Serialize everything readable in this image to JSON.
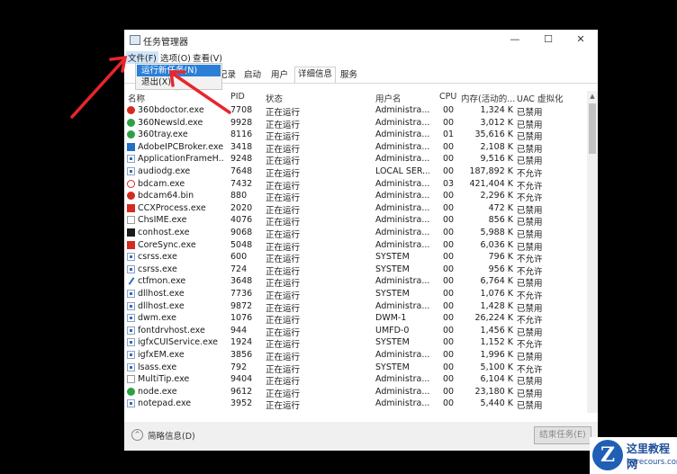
{
  "window": {
    "title": "任务管理器",
    "minimize": "—",
    "maximize": "☐",
    "close": "✕"
  },
  "menu": [
    "文件(F)",
    "选项(O)",
    "查看(V)"
  ],
  "dropdown": [
    "运行新任务(N)",
    "退出(X)"
  ],
  "tabs": [
    "记录",
    "启动",
    "用户",
    "详细信息",
    "服务"
  ],
  "columns": {
    "name": "名称",
    "pid": "PID",
    "status": "状态",
    "user": "用户名",
    "cpu": "CPU",
    "mem": "内存(活动的...",
    "uac": "UAC 虚拟化"
  },
  "processes": [
    {
      "name": "360bdoctor.exe",
      "pid": "7708",
      "status": "正在运行",
      "user": "Administra...",
      "cpu": "00",
      "mem": "1,324 K",
      "uac": "已禁用",
      "icon": "red"
    },
    {
      "name": "360Newsld.exe",
      "pid": "9928",
      "status": "正在运行",
      "user": "Administra...",
      "cpu": "00",
      "mem": "3,012 K",
      "uac": "已禁用",
      "icon": "green"
    },
    {
      "name": "360tray.exe",
      "pid": "8116",
      "status": "正在运行",
      "user": "Administra...",
      "cpu": "01",
      "mem": "35,616 K",
      "uac": "已禁用",
      "icon": "green"
    },
    {
      "name": "AdobeIPCBroker.exe",
      "pid": "3418",
      "status": "正在运行",
      "user": "Administra...",
      "cpu": "00",
      "mem": "2,108 K",
      "uac": "已禁用",
      "icon": "blue"
    },
    {
      "name": "ApplicationFrameH...",
      "pid": "9248",
      "status": "正在运行",
      "user": "Administra...",
      "cpu": "00",
      "mem": "9,516 K",
      "uac": "已禁用",
      "icon": "win"
    },
    {
      "name": "audiodg.exe",
      "pid": "7648",
      "status": "正在运行",
      "user": "LOCAL SER...",
      "cpu": "00",
      "mem": "187,892 K",
      "uac": "不允许",
      "icon": "win"
    },
    {
      "name": "bdcam.exe",
      "pid": "7432",
      "status": "正在运行",
      "user": "Administra...",
      "cpu": "03",
      "mem": "421,404 K",
      "uac": "不允许",
      "icon": "bd"
    },
    {
      "name": "bdcam64.bin",
      "pid": "880",
      "status": "正在运行",
      "user": "Administra...",
      "cpu": "00",
      "mem": "2,296 K",
      "uac": "不允许",
      "icon": "red"
    },
    {
      "name": "CCXProcess.exe",
      "pid": "2020",
      "status": "正在运行",
      "user": "Administra...",
      "cpu": "00",
      "mem": "472 K",
      "uac": "已禁用",
      "icon": "redsq"
    },
    {
      "name": "ChsIME.exe",
      "pid": "4076",
      "status": "正在运行",
      "user": "Administra...",
      "cpu": "00",
      "mem": "856 K",
      "uac": "已禁用",
      "icon": "plain"
    },
    {
      "name": "conhost.exe",
      "pid": "9068",
      "status": "正在运行",
      "user": "Administra...",
      "cpu": "00",
      "mem": "5,988 K",
      "uac": "已禁用",
      "icon": "dark"
    },
    {
      "name": "CoreSync.exe",
      "pid": "5048",
      "status": "正在运行",
      "user": "Administra...",
      "cpu": "00",
      "mem": "6,036 K",
      "uac": "已禁用",
      "icon": "redsq"
    },
    {
      "name": "csrss.exe",
      "pid": "600",
      "status": "正在运行",
      "user": "SYSTEM",
      "cpu": "00",
      "mem": "796 K",
      "uac": "不允许",
      "icon": "win"
    },
    {
      "name": "csrss.exe",
      "pid": "724",
      "status": "正在运行",
      "user": "SYSTEM",
      "cpu": "00",
      "mem": "956 K",
      "uac": "不允许",
      "icon": "win"
    },
    {
      "name": "ctfmon.exe",
      "pid": "3648",
      "status": "正在运行",
      "user": "Administra...",
      "cpu": "00",
      "mem": "6,764 K",
      "uac": "已禁用",
      "icon": "pen"
    },
    {
      "name": "dllhost.exe",
      "pid": "7736",
      "status": "正在运行",
      "user": "SYSTEM",
      "cpu": "00",
      "mem": "1,076 K",
      "uac": "不允许",
      "icon": "win"
    },
    {
      "name": "dllhost.exe",
      "pid": "9872",
      "status": "正在运行",
      "user": "Administra...",
      "cpu": "00",
      "mem": "1,428 K",
      "uac": "已禁用",
      "icon": "win"
    },
    {
      "name": "dwm.exe",
      "pid": "1076",
      "status": "正在运行",
      "user": "DWM-1",
      "cpu": "00",
      "mem": "26,224 K",
      "uac": "不允许",
      "icon": "win"
    },
    {
      "name": "fontdrvhost.exe",
      "pid": "944",
      "status": "正在运行",
      "user": "UMFD-0",
      "cpu": "00",
      "mem": "1,456 K",
      "uac": "已禁用",
      "icon": "win"
    },
    {
      "name": "igfxCUIService.exe",
      "pid": "1924",
      "status": "正在运行",
      "user": "SYSTEM",
      "cpu": "00",
      "mem": "1,152 K",
      "uac": "不允许",
      "icon": "win"
    },
    {
      "name": "igfxEM.exe",
      "pid": "3856",
      "status": "正在运行",
      "user": "Administra...",
      "cpu": "00",
      "mem": "1,996 K",
      "uac": "已禁用",
      "icon": "win"
    },
    {
      "name": "lsass.exe",
      "pid": "792",
      "status": "正在运行",
      "user": "SYSTEM",
      "cpu": "00",
      "mem": "5,100 K",
      "uac": "不允许",
      "icon": "win"
    },
    {
      "name": "MultiTip.exe",
      "pid": "9404",
      "status": "正在运行",
      "user": "Administra...",
      "cpu": "00",
      "mem": "6,104 K",
      "uac": "已禁用",
      "icon": "plain"
    },
    {
      "name": "node.exe",
      "pid": "9612",
      "status": "正在运行",
      "user": "Administra...",
      "cpu": "00",
      "mem": "23,180 K",
      "uac": "已禁用",
      "icon": "green"
    },
    {
      "name": "notepad.exe",
      "pid": "3952",
      "status": "正在运行",
      "user": "Administra...",
      "cpu": "00",
      "mem": "5,440 K",
      "uac": "已禁用",
      "icon": "win"
    }
  ],
  "footer": {
    "collapse_label": "简略信息(D)",
    "end_task": "结束任务(E)"
  },
  "watermark": {
    "name": "这里教程网",
    "url": "herecours.com"
  },
  "colors": {
    "highlight": "#2b7fd6",
    "annotation_arrow": "#e8262b"
  }
}
